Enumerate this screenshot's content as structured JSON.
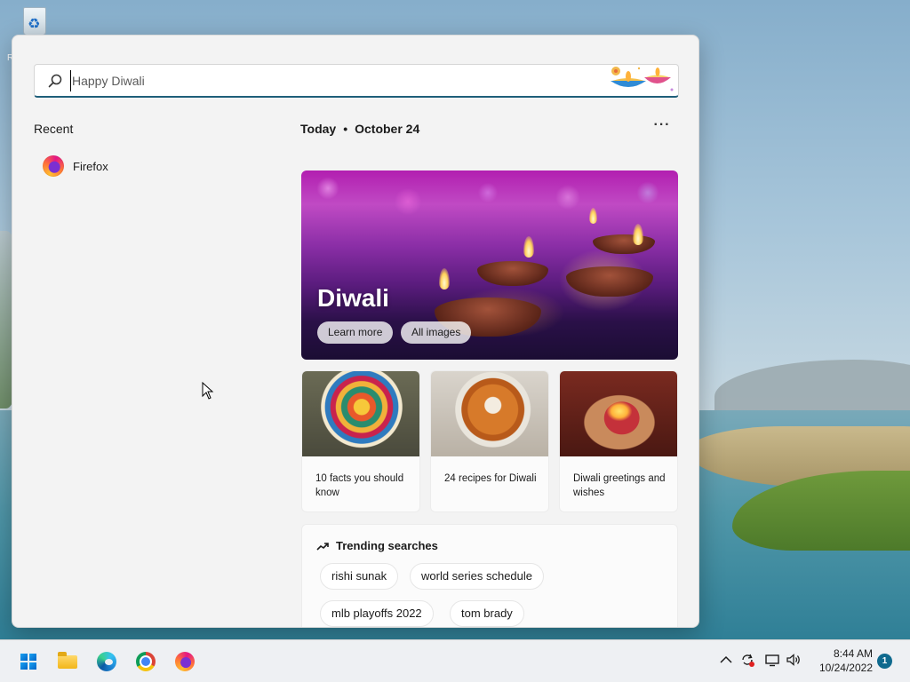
{
  "desktop": {
    "recycle_bin_label": "R"
  },
  "search": {
    "query": "Happy Diwali",
    "icon": "search-icon"
  },
  "recent": {
    "title": "Recent",
    "items": [
      {
        "label": "Firefox",
        "icon": "firefox-icon"
      }
    ]
  },
  "today": {
    "label": "Today",
    "separator": "•",
    "date": "October 24",
    "more_label": "···"
  },
  "hero": {
    "title": "Diwali",
    "buttons": [
      "Learn more",
      "All images"
    ]
  },
  "cards": [
    {
      "caption": "10 facts you should know",
      "image": "rangoli"
    },
    {
      "caption": "24 recipes for Diwali",
      "image": "curry"
    },
    {
      "caption": "Diwali greetings and wishes",
      "image": "diya-hands"
    }
  ],
  "trending": {
    "title": "Trending searches",
    "chips": [
      "rishi sunak",
      "world series schedule",
      "mlb playoffs 2022",
      "tom brady"
    ]
  },
  "taskbar": {
    "apps": [
      "start-button",
      "file-explorer",
      "edge",
      "chrome",
      "firefox"
    ],
    "tray_icons": [
      "chevron-up-icon",
      "sync-icon",
      "display-icon",
      "volume-icon"
    ],
    "time": "8:44 AM",
    "date": "10/24/2022",
    "notification_count": "1"
  },
  "colors": {
    "accent": "#1f5f7a",
    "panel_bg": "#f3f3f3",
    "notification_badge": "#0f6a8e"
  }
}
